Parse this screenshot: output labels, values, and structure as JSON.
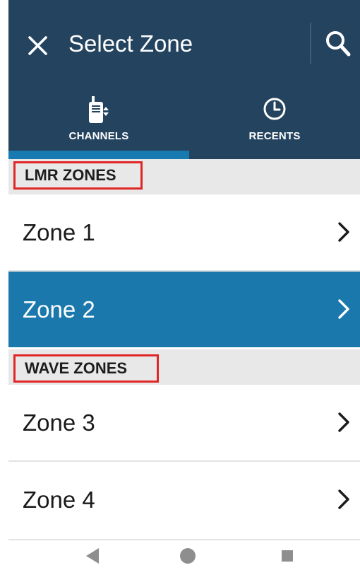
{
  "header": {
    "title": "Select Zone",
    "close_icon": "close-icon",
    "search_icon": "search-icon",
    "bg_color": "#24435f"
  },
  "tabs": [
    {
      "label": "CHANNELS",
      "icon": "radio-icon",
      "selected": true
    },
    {
      "label": "RECENTS",
      "icon": "clock-icon",
      "selected": false
    }
  ],
  "sections": {
    "lmr": {
      "label": "LMR ZONES",
      "items": [
        {
          "label": "Zone 1",
          "selected": false
        },
        {
          "label": "Zone 2",
          "selected": true
        }
      ]
    },
    "wave": {
      "label": "WAVE ZONES",
      "items": [
        {
          "label": "Zone 3",
          "selected": false
        },
        {
          "label": "Zone 4",
          "selected": false
        }
      ]
    }
  },
  "nav": {
    "back_icon": "back-triangle-icon",
    "home_icon": "home-circle-icon",
    "recents_icon": "recents-square-icon"
  },
  "colors": {
    "accent": "#1b78ad",
    "highlight_box": "#e02626",
    "section_bg": "#e8e8e8"
  }
}
